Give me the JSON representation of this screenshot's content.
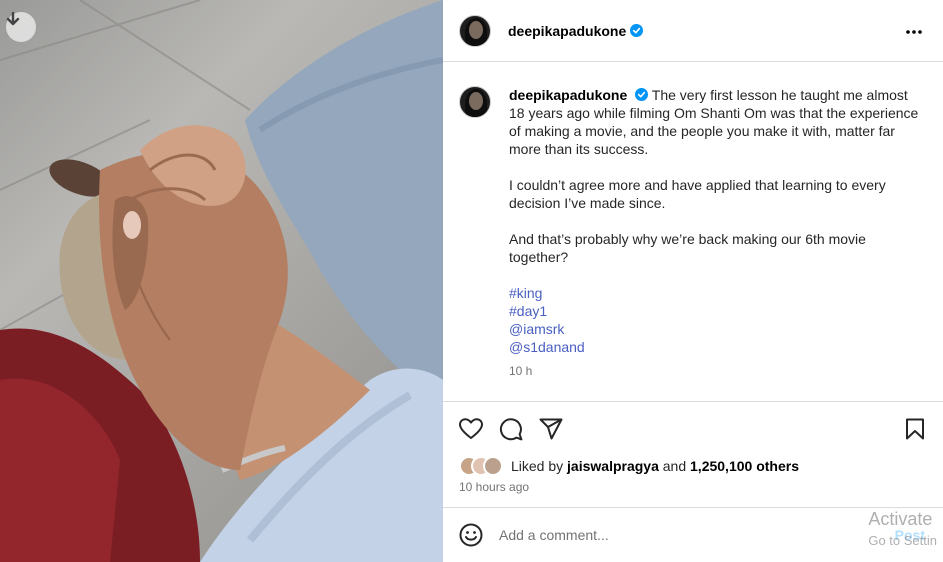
{
  "post": {
    "username": "deepikapadukone",
    "more_icon": "more-horizontal-icon",
    "verified_icon": "verified-badge-icon"
  },
  "caption": {
    "username": "deepikapadukone",
    "paragraphs": [
      "The very first lesson he taught me almost 18 years ago while filming Om Shanti Om was that the experience of making a movie, and the people you make it with, matter far more than its success.",
      "I couldn’t agree more and have applied that learning to every decision I’ve made since.",
      "And that’s probably why we’re back making our 6th movie together?"
    ],
    "tags": [
      "#king",
      "#day1",
      "@iamsrk",
      "@s1danand"
    ],
    "time": "10 h"
  },
  "actions": {
    "like_icon": "heart-icon",
    "comment_icon": "comment-icon",
    "share_icon": "share-icon",
    "save_icon": "bookmark-icon"
  },
  "likes": {
    "prefix": "Liked by",
    "user": "jaiswalpragya",
    "connector": "and",
    "count": "1,250,100 others"
  },
  "post_time": "10 hours ago",
  "comment": {
    "placeholder": "Add a comment...",
    "post_label": "Post",
    "emoji_icon": "emoji-icon"
  },
  "watermark": {
    "line1": "Activate",
    "line2": "Go to Settin"
  },
  "photo": {
    "download_icon": "download-arrow-icon"
  },
  "colors": {
    "link": "#4a5fc1",
    "verified": "#0095f6",
    "post_disabled": "#b2dffc",
    "divider": "#dbdbdb"
  }
}
